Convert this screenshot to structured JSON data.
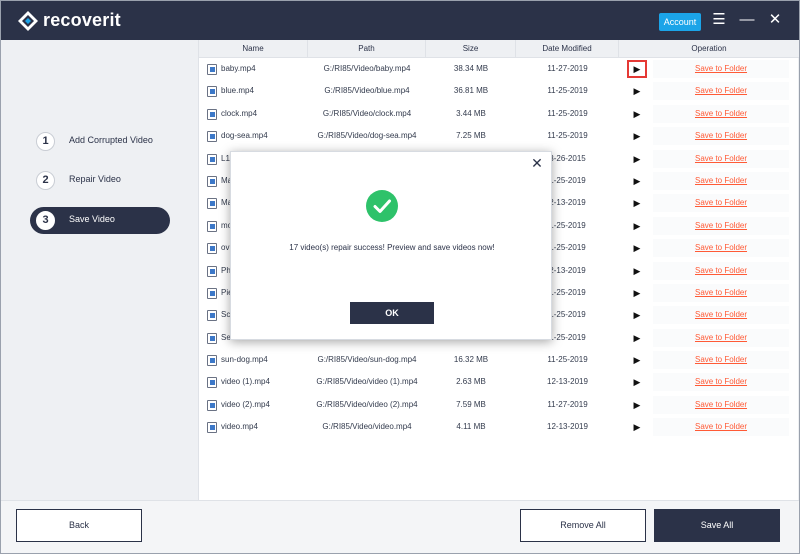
{
  "app": {
    "brand": "recoverit",
    "account_label": "Account"
  },
  "steps": [
    {
      "num": "1",
      "label": "Add Corrupted Video"
    },
    {
      "num": "2",
      "label": "Repair Video"
    },
    {
      "num": "3",
      "label": "Save Video"
    }
  ],
  "table": {
    "headers": {
      "name": "Name",
      "path": "Path",
      "size": "Size",
      "date": "Date Modified",
      "operation": "Operation"
    },
    "save_label": "Save to Folder",
    "rows": [
      {
        "name": "baby.mp4",
        "path": "G:/RI85/Video/baby.mp4",
        "size": "38.34 MB",
        "date": "11-27-2019"
      },
      {
        "name": "blue.mp4",
        "path": "G:/RI85/Video/blue.mp4",
        "size": "36.81 MB",
        "date": "11-25-2019"
      },
      {
        "name": "clock.mp4",
        "path": "G:/RI85/Video/clock.mp4",
        "size": "3.44 MB",
        "date": "11-25-2019"
      },
      {
        "name": "dog-sea.mp4",
        "path": "G:/RI85/Video/dog-sea.mp4",
        "size": "7.25 MB",
        "date": "11-25-2019"
      },
      {
        "name": "L1",
        "path": "",
        "size": "",
        "date": "3-26-2015"
      },
      {
        "name": "Ma",
        "path": "",
        "size": "",
        "date": "1-25-2019"
      },
      {
        "name": "Ma",
        "path": "",
        "size": "",
        "date": "2-13-2019"
      },
      {
        "name": "mo",
        "path": "",
        "size": "",
        "date": "1-25-2019"
      },
      {
        "name": "ov",
        "path": "",
        "size": "",
        "date": "1-25-2019"
      },
      {
        "name": "Ph",
        "path": "",
        "size": "",
        "date": "2-13-2019"
      },
      {
        "name": "Pie",
        "path": "",
        "size": "",
        "date": "1-25-2019"
      },
      {
        "name": "Sc",
        "path": "",
        "size": "",
        "date": "1-25-2019"
      },
      {
        "name": "Sea",
        "path": "",
        "size": "",
        "date": "1-25-2019"
      },
      {
        "name": "sun-dog.mp4",
        "path": "G:/RI85/Video/sun-dog.mp4",
        "size": "16.32 MB",
        "date": "11-25-2019"
      },
      {
        "name": "video (1).mp4",
        "path": "G:/RI85/Video/video (1).mp4",
        "size": "2.63 MB",
        "date": "12-13-2019"
      },
      {
        "name": "video (2).mp4",
        "path": "G:/RI85/Video/video (2).mp4",
        "size": "7.59 MB",
        "date": "11-27-2019"
      },
      {
        "name": "video.mp4",
        "path": "G:/RI85/Video/video.mp4",
        "size": "4.11 MB",
        "date": "12-13-2019"
      }
    ]
  },
  "footer": {
    "back_label": "Back",
    "remove_all_label": "Remove All",
    "save_all_label": "Save All"
  },
  "modal": {
    "message": "17 video(s) repair success! Preview and save videos now!",
    "ok_label": "OK",
    "close_glyph": "✕"
  },
  "icons": {
    "play": "▶",
    "menu": "☰",
    "minimize": "—",
    "close": "✕"
  },
  "colors": {
    "accent_dark": "#2b3248",
    "account_blue": "#1ba4e8",
    "link_red": "#ff5a36",
    "success_green": "#2ec26a"
  }
}
